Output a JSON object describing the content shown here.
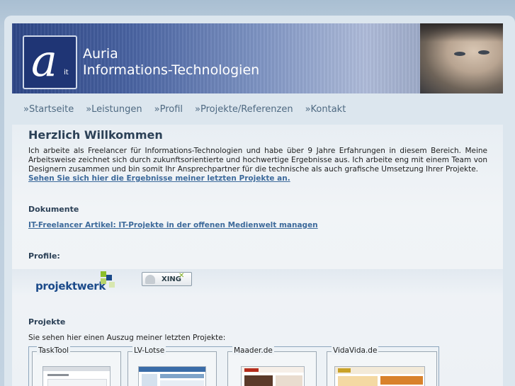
{
  "brand": {
    "logo_letter": "a",
    "logo_sub": "it",
    "line1": "Auria",
    "line2": "Informations-Technologien"
  },
  "nav": [
    {
      "label": "»Startseite"
    },
    {
      "label": "»Leistungen"
    },
    {
      "label": "»Profil"
    },
    {
      "label": "»Projekte/Referenzen"
    },
    {
      "label": "»Kontakt"
    }
  ],
  "welcome": {
    "title": "Herzlich Willkommen",
    "text": "Ich arbeite als Freelancer für Informations-Technologien und habe über 9 Jahre Erfahrungen in diesem Bereich. Meine Arbeitsweise zeichnet sich durch zukunftsorientierte und hochwertige Ergebnisse aus. Ich arbeite eng mit einem Team von Designern zusammen und bin somit Ihr Ansprechpartner für die technische als auch grafische Umsetzung Ihrer Projekte.",
    "link": "Sehen Sie sich hier die Ergebnisse meiner letzten Projekte an."
  },
  "dokumente": {
    "heading": "Dokumente",
    "link": "IT-Freelancer Artikel: IT-Projekte in der offenen Medienwelt managen"
  },
  "profile": {
    "heading": "Profile:",
    "projektwerk": "projektwerk",
    "xing": "XING"
  },
  "projekte": {
    "heading": "Projekte",
    "intro": "Sie sehen hier einen Auszug meiner letzten Projekte:",
    "items": [
      {
        "name": "TaskTool"
      },
      {
        "name": "LV-Lotse"
      },
      {
        "name": "Maader.de"
      },
      {
        "name": "VidaVida.de"
      }
    ]
  },
  "colors": {
    "accent": "#3d6a9b",
    "heading": "#2c4157",
    "banner": "#2d4686"
  }
}
